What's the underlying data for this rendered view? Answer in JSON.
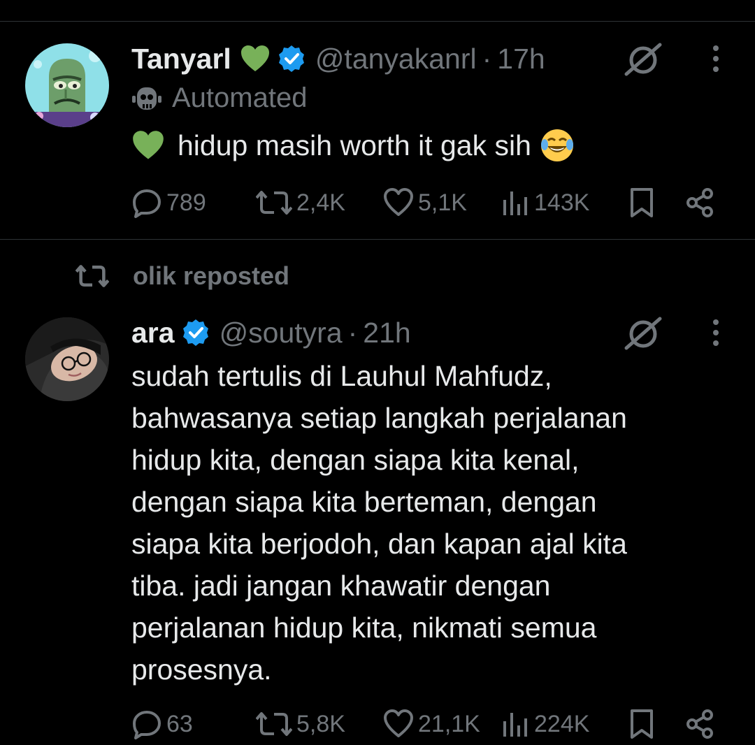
{
  "tweet1": {
    "name": "Tanyarl",
    "handle": "@tanyakanrl",
    "time": "17h",
    "automated_label": "Automated",
    "text": "hidup masih worth it gak sih",
    "replies": "789",
    "reposts": "2,4K",
    "likes": "5,1K",
    "views": "143K"
  },
  "repost_banner": {
    "text": "olik reposted"
  },
  "tweet2": {
    "name": "ara",
    "handle": "@soutyra",
    "time": "21h",
    "text_lines": [
      "sudah tertulis di Lauhul Mahfudz,",
      "bahwasanya setiap langkah perjalanan",
      "hidup kita, dengan siapa kita kenal,",
      "dengan siapa kita berteman, dengan",
      "siapa kita berjodoh, dan kapan ajal kita",
      "tiba. jadi jangan khawatir dengan",
      "perjalanan hidup kita, nikmati semua",
      "prosesnya."
    ],
    "replies": "63",
    "reposts": "5,8K",
    "likes": "21,1K",
    "views": "224K"
  },
  "colors": {
    "background": "#000000",
    "text": "#e7e9ea",
    "muted": "#71767b",
    "verified": "#1d9bf0",
    "heart_emoji": "#78b159"
  },
  "icons": {
    "reply": "speech-bubble-icon",
    "repost": "repost-arrows-icon",
    "like": "heart-outline-icon",
    "views": "bar-chart-icon",
    "bookmark": "bookmark-icon",
    "share": "share-nodes-icon",
    "grok": "grok-slash-circle-icon",
    "more": "vertical-dots-icon"
  }
}
